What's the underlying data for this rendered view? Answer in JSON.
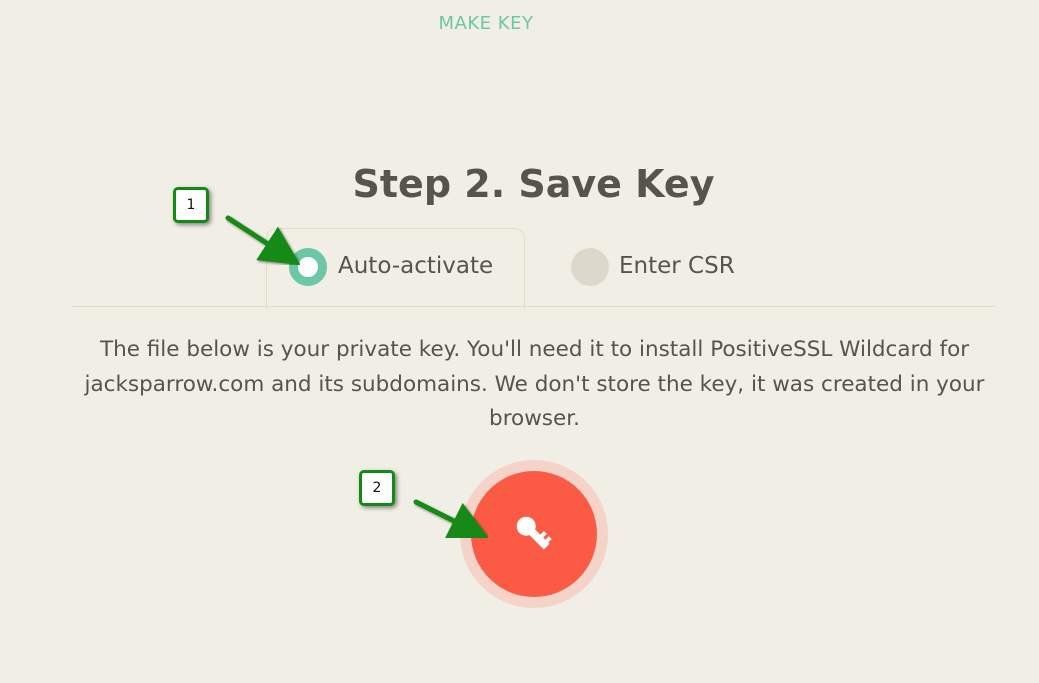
{
  "header": {
    "make_key_link": "MAKE KEY"
  },
  "step": {
    "title": "Step 2. Save Key"
  },
  "options": {
    "auto_activate": {
      "label": "Auto-activate",
      "selected": true
    },
    "enter_csr": {
      "label": "Enter CSR",
      "selected": false
    }
  },
  "info": {
    "text": "The file below is your private key. You'll need it to install PositiveSSL Wildcard for jacksparrow.com and its subdomains. We don't store the key, it was created in your browser."
  },
  "download": {
    "icon": "key-icon",
    "color": "#fb5a44",
    "halo_color": "#f6d3c9"
  },
  "annotations": {
    "callout_1": "1",
    "callout_2": "2",
    "color": "#138a13"
  },
  "colors": {
    "accent": "#6cc7a6",
    "background": "#f1eee5",
    "text": "#55544d"
  }
}
